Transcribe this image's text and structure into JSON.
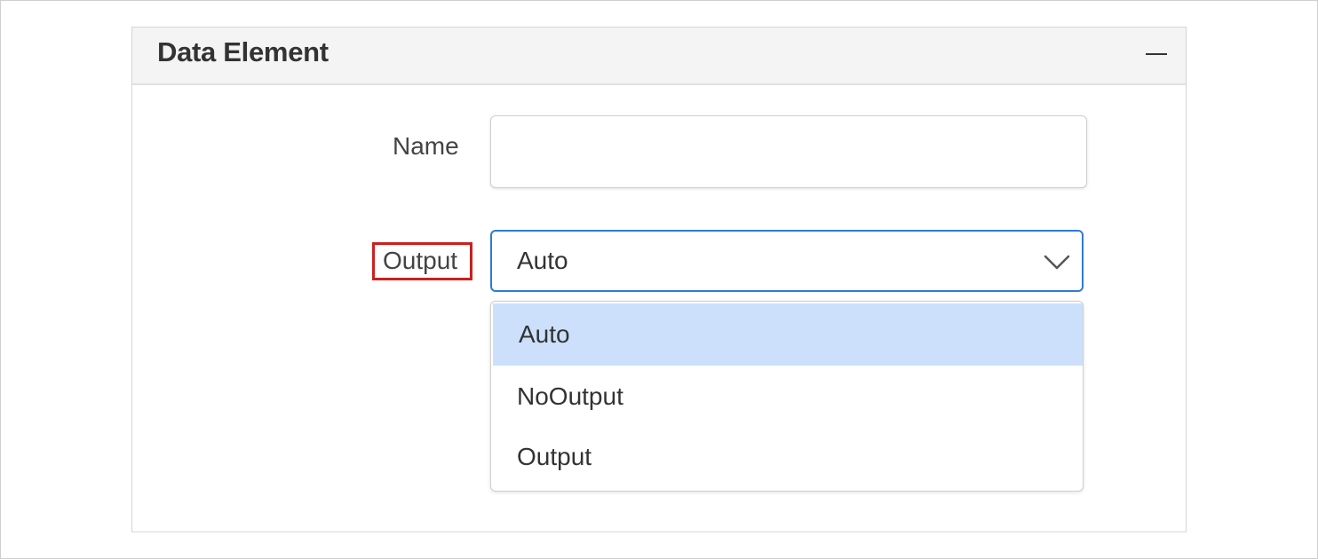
{
  "panel": {
    "title": "Data Element",
    "collapse_icon": "minus-icon"
  },
  "fields": {
    "name": {
      "label": "Name",
      "value": "",
      "placeholder": ""
    },
    "output": {
      "label": "Output",
      "selected_value": "Auto",
      "options": [
        "Auto",
        "NoOutput",
        "Output"
      ],
      "highlighted_option": "Auto",
      "icon": "chevron-down-icon"
    }
  },
  "colors": {
    "header_bg": "#f4f4f4",
    "select_border": "#2f7bd6",
    "highlight_bg": "#cce0fb",
    "annotation_red": "#cc1f1f"
  }
}
